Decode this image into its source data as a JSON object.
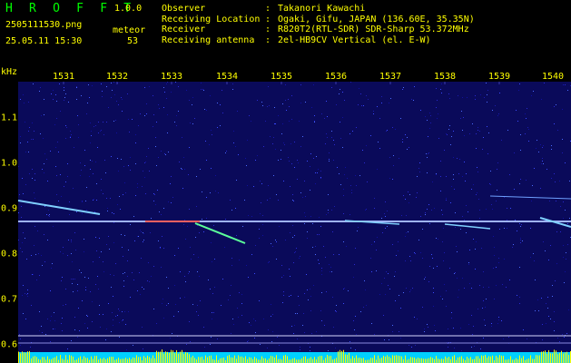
{
  "app": {
    "title": "H R O F F T",
    "version": "1.0.0"
  },
  "file": {
    "name": "2505111530.png",
    "datetime": "25.05.11 15:30"
  },
  "meteor": {
    "label": "meteor",
    "count": "53"
  },
  "info": [
    {
      "label": "Observer",
      "value": "Takanori Kawachi"
    },
    {
      "label": "Receiving Location",
      "value": "Ogaki, Gifu, JAPAN (136.60E, 35.35N)"
    },
    {
      "label": "Receiver",
      "value": "R820T2(RTL-SDR) SDR-Sharp 53.372MHz"
    },
    {
      "label": "Receiving antenna",
      "value": "2el-HB9CV Vertical (el. E-W)"
    }
  ],
  "axis": {
    "unit": "kHz",
    "time_ticks": [
      "1531",
      "1532",
      "1533",
      "1534",
      "1535",
      "1536",
      "1537",
      "1538",
      "1539",
      "1540"
    ],
    "freq_ticks": [
      "1.1",
      "1.0",
      "0.9",
      "0.8",
      "0.7",
      "0.6"
    ]
  },
  "colors": {
    "background": "#000000",
    "text": "#ffff00",
    "title": "#00ff00",
    "noise": "#1a1aa0",
    "carrier": "#9fb3ff"
  }
}
